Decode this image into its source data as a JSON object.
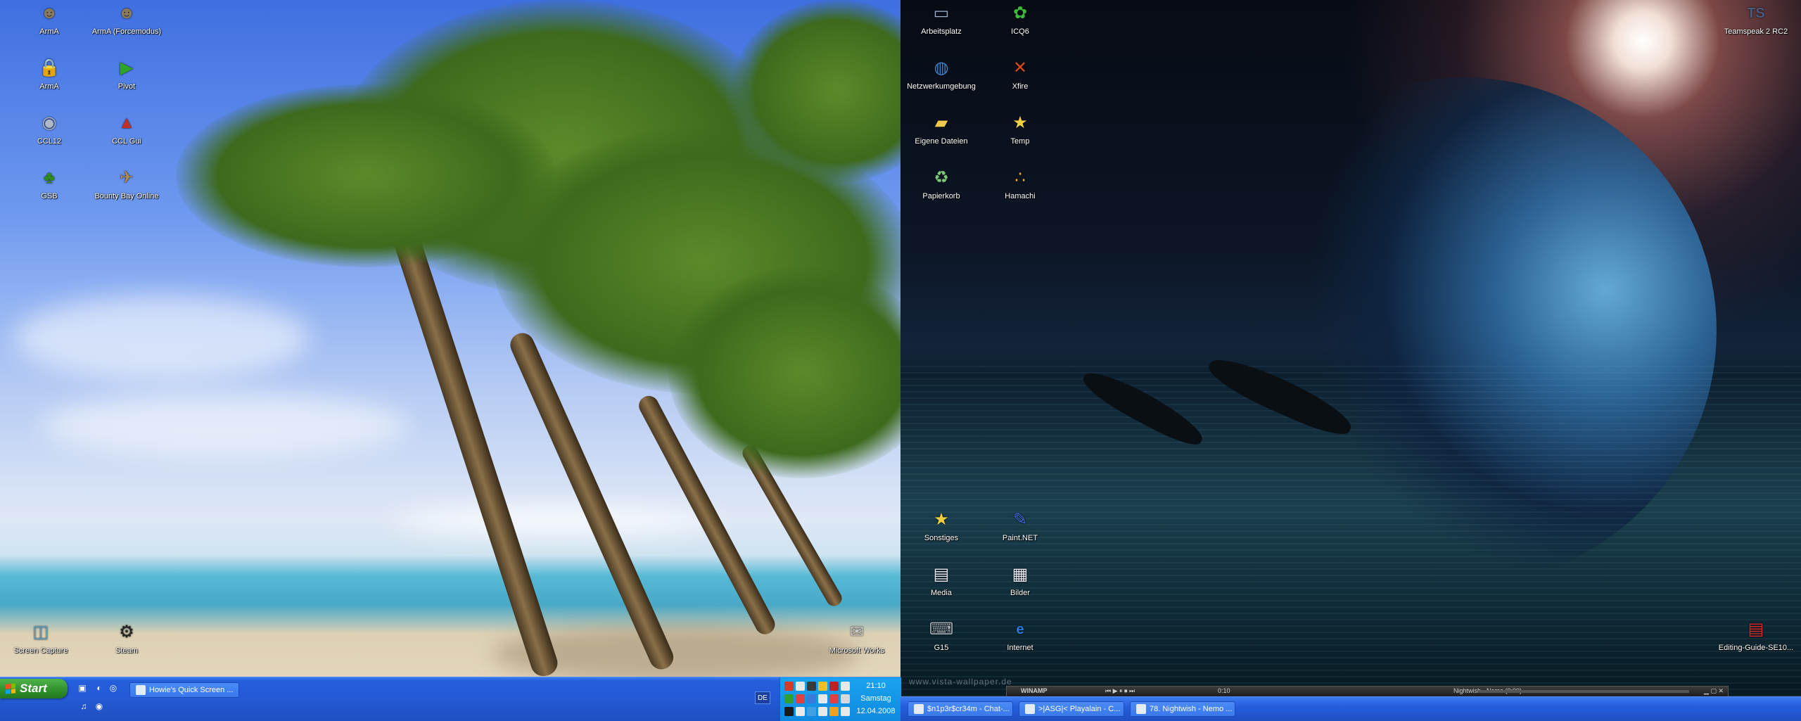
{
  "desktop_left": {
    "icons": [
      {
        "id": "arma",
        "label": "ArmA",
        "icon": "soldier-icon",
        "color": "#8a7a5a"
      },
      {
        "id": "arma-forcemode",
        "label": "ArmA (Forcemodus)",
        "icon": "soldier-icon",
        "color": "#8a7a5a"
      },
      {
        "id": "arma2",
        "label": "ArmA",
        "icon": "lock-icon",
        "color": "#e8c23a"
      },
      {
        "id": "pivot",
        "label": "Pivot",
        "icon": "play-arrow-icon",
        "color": "#2fa32a"
      },
      {
        "id": "ccl",
        "label": "CCL12",
        "icon": "disc-icon",
        "color": "#b0b8c8"
      },
      {
        "id": "ccl-ui",
        "label": "CCL Gui",
        "icon": "warning-icon",
        "color": "#c0302a"
      },
      {
        "id": "gsb",
        "label": "GSB",
        "icon": "tree-icon",
        "color": "#2e8a20"
      },
      {
        "id": "bounty-bay",
        "label": "Bounty Bay Online",
        "icon": "map-icon",
        "color": "#b08850"
      },
      {
        "id": "screen-capture",
        "label": "Screen Capture",
        "icon": "camera-icon",
        "color": "#5aa0c8"
      },
      {
        "id": "steam",
        "label": "Steam",
        "icon": "steam-icon",
        "color": "#222222"
      },
      {
        "id": "microsoft-works",
        "label": "Microsoft Works",
        "icon": "works-icon",
        "color": "#c8c8c8"
      }
    ]
  },
  "desktop_right": {
    "icons": [
      {
        "id": "arbeitsplatz",
        "label": "Arbeitsplatz",
        "icon": "computer-icon",
        "color": "#9ab4d8"
      },
      {
        "id": "icq6",
        "label": "ICQ6",
        "icon": "flower-icon",
        "color": "#3cb83c"
      },
      {
        "id": "netzwerk",
        "label": "Netzwerkumgebung",
        "icon": "network-icon",
        "color": "#3a8ad8"
      },
      {
        "id": "xfire",
        "label": "Xfire",
        "icon": "xfire-icon",
        "color": "#d84a1a"
      },
      {
        "id": "eigene-dateien",
        "label": "Eigene Dateien",
        "icon": "folder-icon",
        "color": "#f0c850"
      },
      {
        "id": "temp",
        "label": "Temp",
        "icon": "star-icon",
        "color": "#f0d040"
      },
      {
        "id": "papierkorb",
        "label": "Papierkorb",
        "icon": "recycle-bin-icon",
        "color": "#7ac87a"
      },
      {
        "id": "hamachi",
        "label": "Hamachi",
        "icon": "hamachi-icon",
        "color": "#f0b020"
      },
      {
        "id": "sonstiges",
        "label": "Sonstiges",
        "icon": "star-icon",
        "color": "#f0d040"
      },
      {
        "id": "paint-net",
        "label": "Paint.NET",
        "icon": "paint-icon",
        "color": "#3a6ad8"
      },
      {
        "id": "media",
        "label": "Media",
        "icon": "document-icon",
        "color": "#e8e8f0"
      },
      {
        "id": "bilder",
        "label": "Bilder",
        "icon": "images-icon",
        "color": "#e8e8f0"
      },
      {
        "id": "g15",
        "label": "G15",
        "icon": "keyboard-icon",
        "color": "#a0a8b0"
      },
      {
        "id": "internet",
        "label": "Internet",
        "icon": "ie-icon",
        "color": "#2a7ad8"
      },
      {
        "id": "teamspeak",
        "label": "Teamspeak 2 RC2",
        "icon": "teamspeak-icon",
        "color": "#4a5a7a"
      },
      {
        "id": "editing-guide",
        "label": "Editing-Guide-SE10...",
        "icon": "pdf-icon",
        "color": "#d82a2a"
      }
    ],
    "watermark": "www.vista-wallpaper.de"
  },
  "taskbar_left": {
    "start_label": "Start",
    "quicklaunch": [
      {
        "id": "ql-1",
        "icon": "desktop-icon"
      },
      {
        "id": "ql-2",
        "icon": "firefox-icon"
      },
      {
        "id": "ql-3",
        "icon": "media-icon"
      },
      {
        "id": "ql-4",
        "icon": "winamp-icon"
      },
      {
        "id": "ql-5",
        "icon": "disc-icon"
      }
    ],
    "tasks": [
      {
        "label": "Howie's Quick Screen ...",
        "icon": "camera-icon"
      }
    ],
    "language": "DE",
    "clock": {
      "time": "21:10",
      "day": "Samstag",
      "date": "12.04.2008"
    }
  },
  "taskbar_right": {
    "tasks": [
      {
        "label": "$n1p3r$cr34m - Chat-...",
        "icon": "chat-icon"
      },
      {
        "label": ">|ASG|< Playalain - C...",
        "icon": "chat-icon"
      },
      {
        "label": "78. Nightwish - Nemo ...",
        "icon": "winamp-icon"
      }
    ]
  },
  "winamp": {
    "title": "WINAMP",
    "time": "0:10",
    "track": "Nightwish - Nemo (0:00)"
  },
  "colors": {
    "taskbar_blue": "#245edb",
    "start_green": "#2f8f2b",
    "tray_blue": "#0f8ae0"
  }
}
